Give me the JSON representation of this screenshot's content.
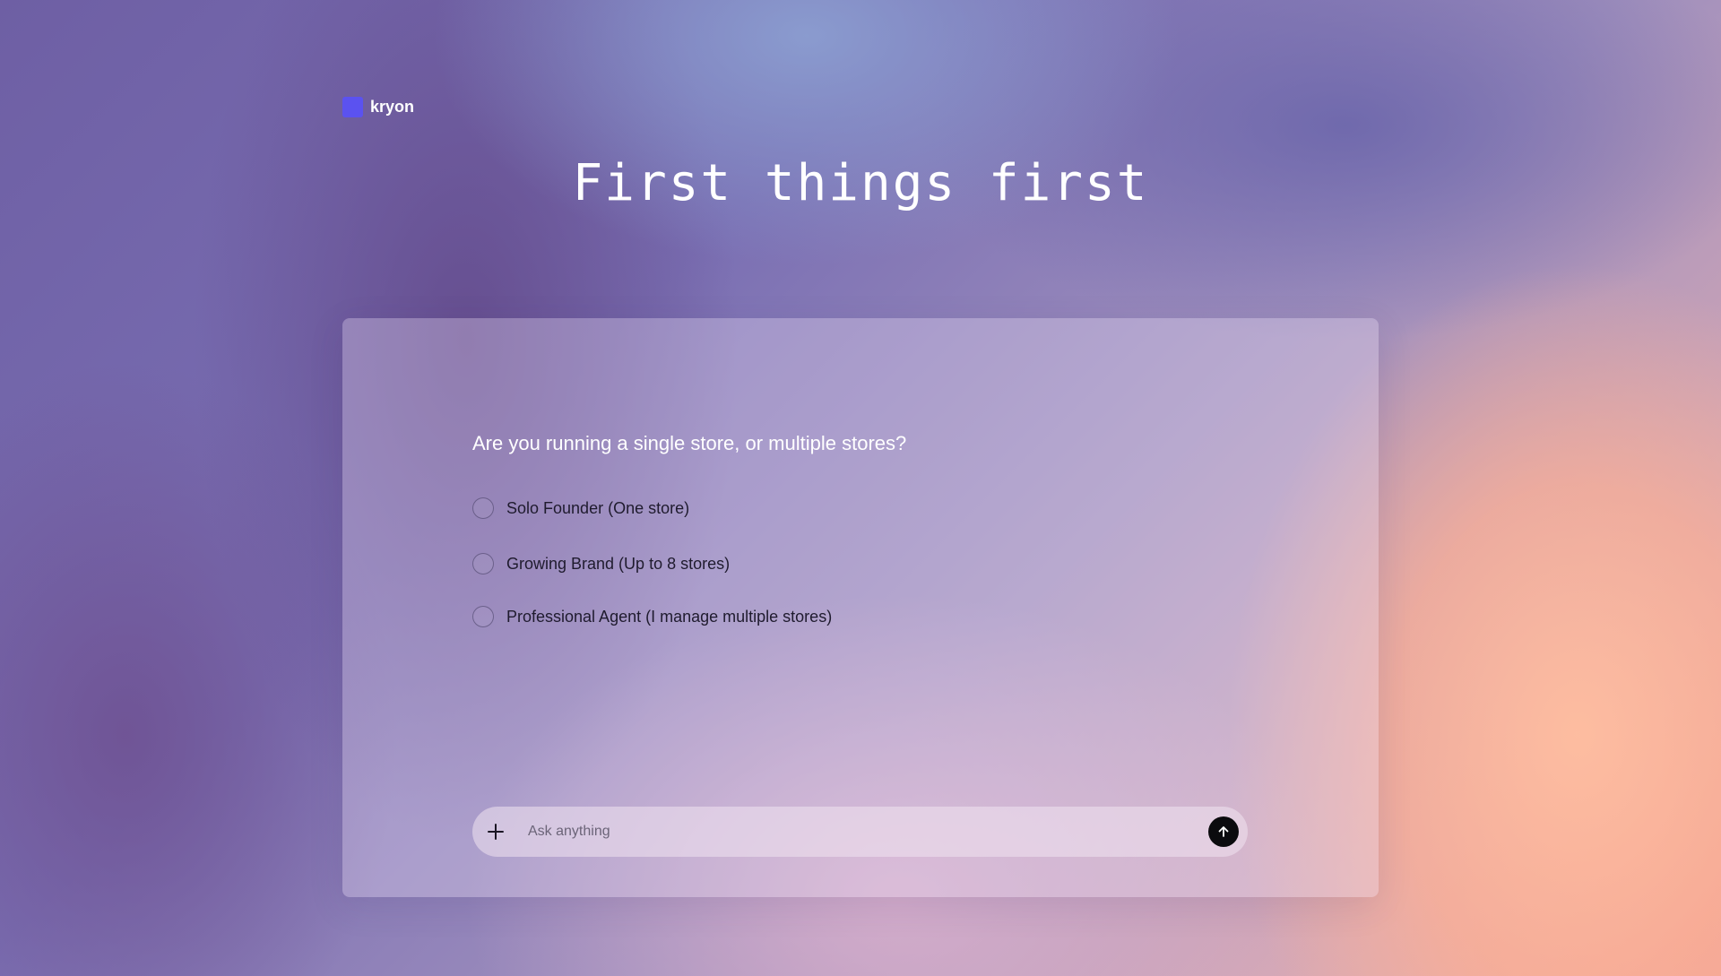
{
  "brand": {
    "name": "kryon",
    "color": "#5b52f0"
  },
  "headline": "First things first",
  "card": {
    "question": "Are you running a single store, or multiple stores?",
    "options": [
      {
        "label": "Solo Founder (One store)",
        "selected": false
      },
      {
        "label": "Growing Brand (Up to 8 stores)",
        "selected": false
      },
      {
        "label": "Professional Agent (I manage multiple stores)",
        "selected": false
      }
    ]
  },
  "composer": {
    "placeholder": "Ask anything",
    "value": "",
    "attach_icon": "plus-icon",
    "send_icon": "arrow-up-icon"
  }
}
